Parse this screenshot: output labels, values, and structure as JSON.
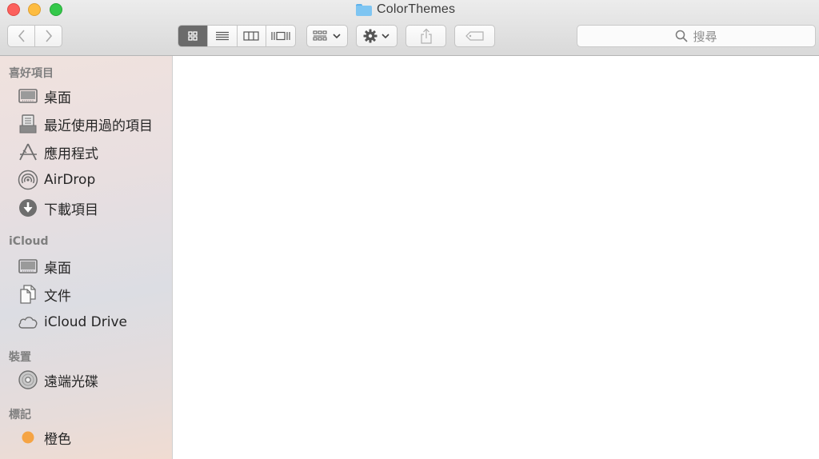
{
  "window": {
    "title": "ColorThemes"
  },
  "toolbar": {
    "back_icon": "chevron-left-icon",
    "forward_icon": "chevron-right-icon",
    "views": [
      {
        "name": "icon-view",
        "icon": "grid-icon",
        "active": true
      },
      {
        "name": "list-view",
        "icon": "list-icon",
        "active": false
      },
      {
        "name": "column-view",
        "icon": "columns-icon",
        "active": false
      },
      {
        "name": "cover-flow-view",
        "icon": "coverflow-icon",
        "active": false
      }
    ],
    "arrange_icon": "arrange-grid-icon",
    "action_icon": "gear-icon",
    "share_icon": "share-icon",
    "tags_icon": "tag-icon",
    "search_placeholder": "搜尋"
  },
  "sidebar": {
    "sections": [
      {
        "header": "喜好項目",
        "items": [
          {
            "label": "桌面",
            "icon": "desktop-icon"
          },
          {
            "label": "最近使用過的項目",
            "icon": "recents-icon"
          },
          {
            "label": "應用程式",
            "icon": "applications-icon"
          },
          {
            "label": "AirDrop",
            "icon": "airdrop-icon"
          },
          {
            "label": "下載項目",
            "icon": "downloads-icon"
          }
        ]
      },
      {
        "header": "iCloud",
        "items": [
          {
            "label": "桌面",
            "icon": "desktop-icon"
          },
          {
            "label": "文件",
            "icon": "documents-icon"
          },
          {
            "label": "iCloud Drive",
            "icon": "cloud-icon"
          }
        ]
      },
      {
        "header": "裝置",
        "items": [
          {
            "label": "遠端光碟",
            "icon": "disc-icon"
          }
        ]
      },
      {
        "header": "標記",
        "items": [
          {
            "label": "橙色",
            "icon": "tag-dot-icon",
            "color": "#f5a444"
          }
        ]
      }
    ]
  },
  "colors": {
    "active_view": "#6b6b6b",
    "orange_tag": "#f5a444",
    "folder": "#7ec5f2"
  }
}
